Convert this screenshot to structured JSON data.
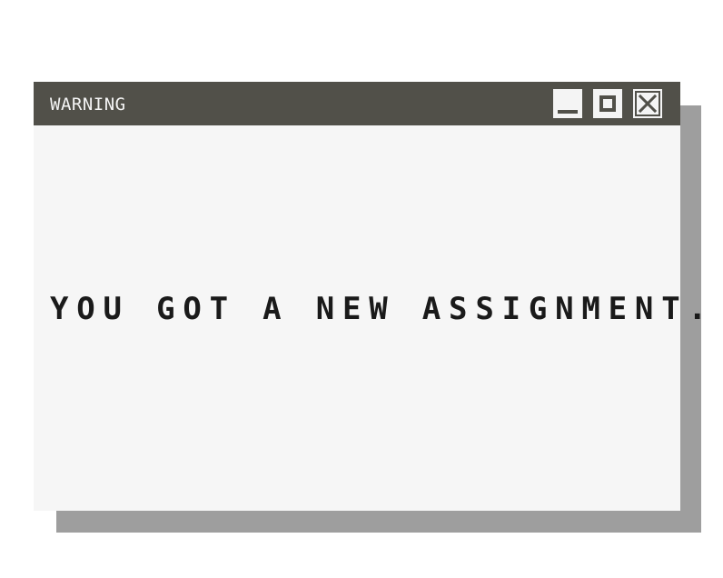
{
  "window": {
    "title": "WARNING",
    "message": "YOU GOT A NEW ASSIGNMENT.",
    "controls": {
      "minimize_icon": "minimize-icon",
      "maximize_icon": "maximize-icon",
      "close_icon": "close-icon"
    }
  },
  "colors": {
    "titlebar": "#515049",
    "title_text": "#f4f4f4",
    "window_body": "#f6f6f6",
    "shadow": "#9e9e9e",
    "message_text": "#1a1a1a"
  }
}
